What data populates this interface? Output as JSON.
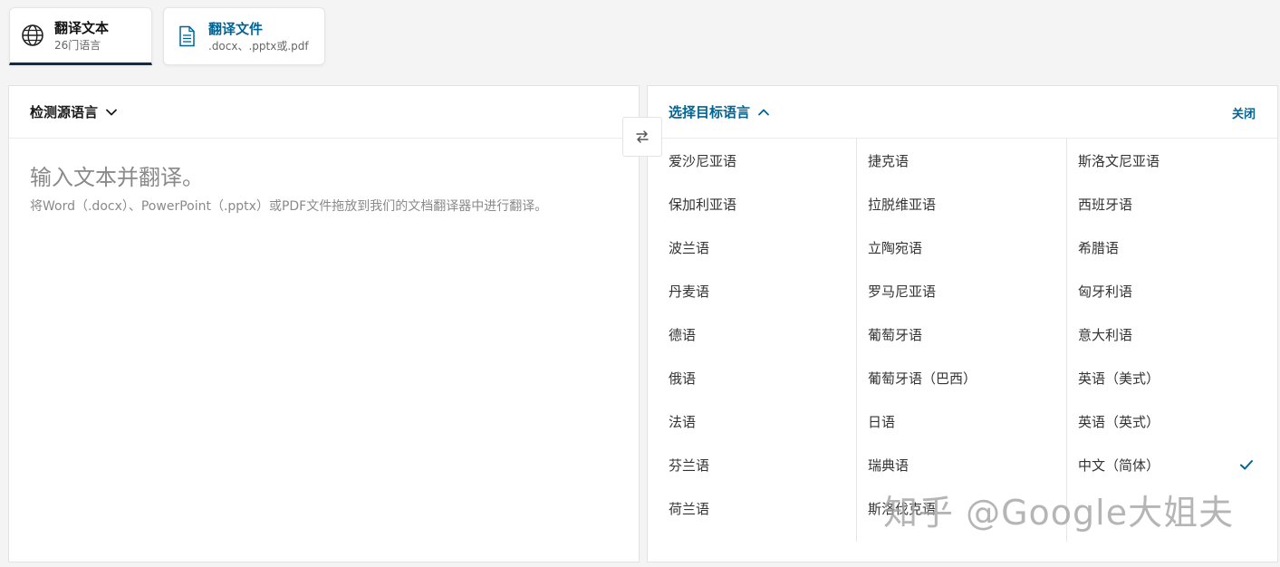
{
  "tabs": [
    {
      "title": "翻译文本",
      "subtitle": "26门语言",
      "icon": "globe-icon"
    },
    {
      "title": "翻译文件",
      "subtitle": ".docx、.pptx或.pdf",
      "icon": "document-icon"
    }
  ],
  "source": {
    "language_label": "检测源语言",
    "placeholder": "输入文本并翻译。",
    "hint": "将Word（.docx）、PowerPoint（.pptx）或PDF文件拖放到我们的文档翻译器中进行翻译。"
  },
  "target": {
    "language_label": "选择目标语言",
    "close_label": "关闭",
    "selected": "中文（简体）",
    "columns": [
      [
        "爱沙尼亚语",
        "保加利亚语",
        "波兰语",
        "丹麦语",
        "德语",
        "俄语",
        "法语",
        "芬兰语",
        "荷兰语"
      ],
      [
        "捷克语",
        "拉脱维亚语",
        "立陶宛语",
        "罗马尼亚语",
        "葡萄牙语",
        "葡萄牙语（巴西）",
        "日语",
        "瑞典语",
        "斯洛伐克语"
      ],
      [
        "斯洛文尼亚语",
        "西班牙语",
        "希腊语",
        "匈牙利语",
        "意大利语",
        "英语（美式）",
        "英语（英式）",
        "中文（简体）"
      ]
    ]
  },
  "watermark": "知乎 @Google大姐夫",
  "colors": {
    "accent": "#006494",
    "tab_underline": "#0f2b46",
    "placeholder": "#8a8a8a"
  }
}
